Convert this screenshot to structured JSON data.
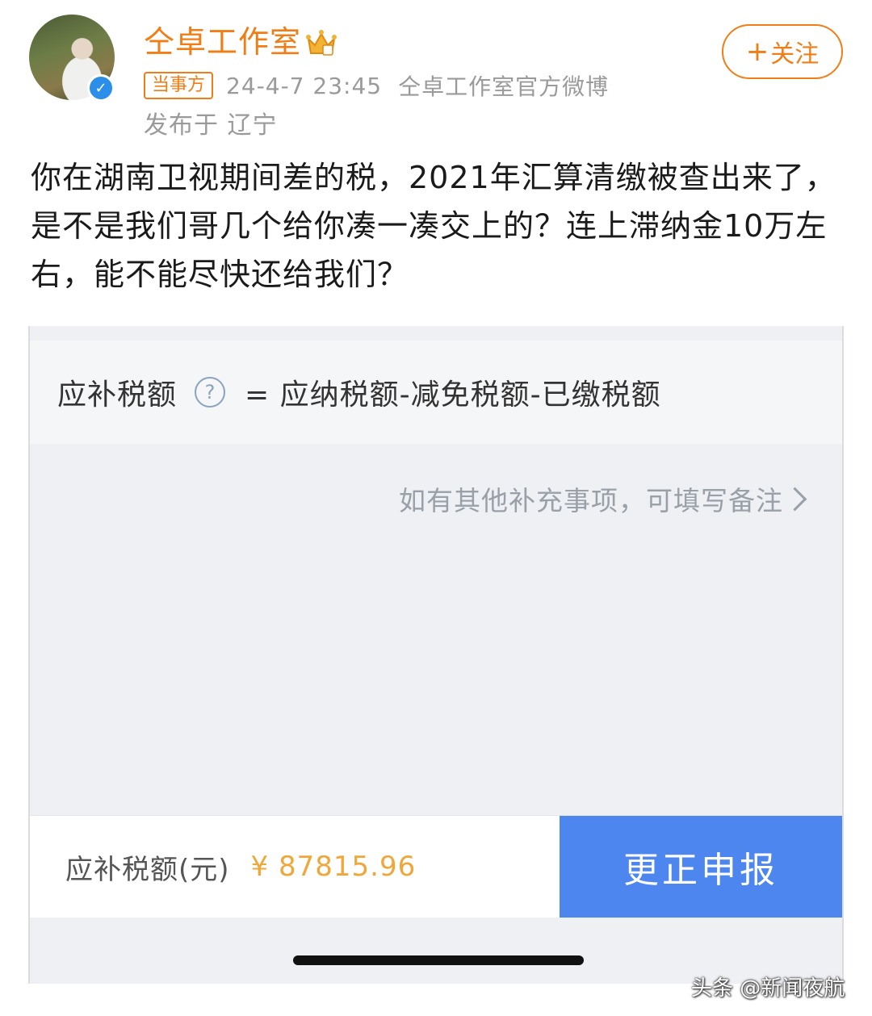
{
  "post": {
    "username": "仝卓工作室",
    "follow_label": "关注",
    "tag": "当事方",
    "timestamp": "24-4-7 23:45",
    "source": "仝卓工作室官方微博",
    "location": "发布于 辽宁",
    "text": "你在湖南卫视期间差的税，2021年汇算清缴被查出来了，是不是我们哥几个给你凑一凑交上的？连上滞纳金10万左右，能不能尽快还给我们？"
  },
  "screenshot": {
    "formula_label": "应补税额",
    "formula": "= 应纳税额-减免税额-已缴税额",
    "note_placeholder": "如有其他补充事项，可填写备注",
    "amount_label": "应补税额(元)",
    "amount_value": "¥ 87815.96",
    "correct_button": "更正申报"
  },
  "watermark": "头条 @新闻夜航",
  "colors": {
    "accent_orange": "#f07d15",
    "button_blue": "#4d86ee",
    "amount_orange": "#f0a73a",
    "verified_blue": "#2b8ee8"
  }
}
